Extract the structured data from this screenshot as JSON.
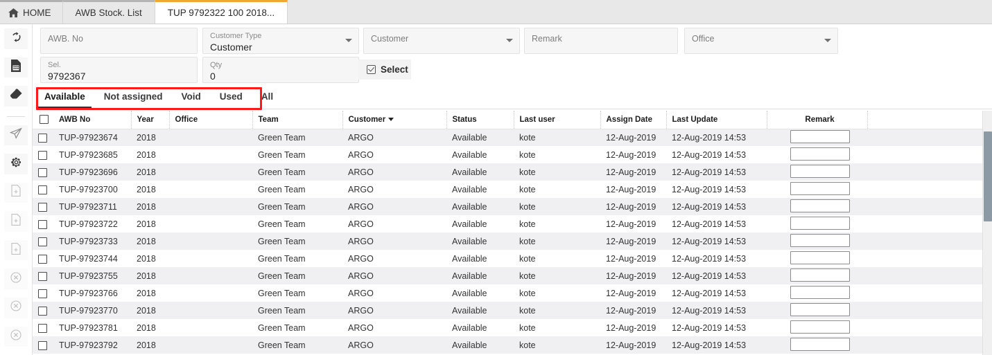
{
  "tabs": [
    {
      "label": "HOME",
      "icon": "home-icon",
      "active": false
    },
    {
      "label": "AWB Stock. List",
      "icon": "",
      "active": false
    },
    {
      "label": "TUP 9792322 100 2018...",
      "icon": "",
      "active": true
    }
  ],
  "rail": [
    {
      "name": "refresh-icon",
      "dim": false
    },
    {
      "name": "report-document-icon",
      "dim": false
    },
    {
      "name": "eraser-icon",
      "dim": false
    },
    {
      "name": "send-icon",
      "dim": false
    },
    {
      "name": "settings-gear-icon",
      "dim": false
    },
    {
      "name": "new-file-icon",
      "dim": true
    },
    {
      "name": "new-file-icon",
      "dim": true
    },
    {
      "name": "new-file-icon",
      "dim": true
    },
    {
      "name": "cancel-circle-icon",
      "dim": true
    },
    {
      "name": "cancel-circle-icon",
      "dim": true
    },
    {
      "name": "cancel-circle-icon",
      "dim": true
    }
  ],
  "form": {
    "awb_no": {
      "label": "AWB. No",
      "value": ""
    },
    "customer_type": {
      "label": "Customer Type",
      "value": "Customer"
    },
    "customer": {
      "label": "Customer",
      "value": ""
    },
    "remark": {
      "label": "Remark",
      "value": ""
    },
    "office": {
      "label": "Office",
      "value": ""
    },
    "sel": {
      "label": "Sel.",
      "value": "9792367"
    },
    "qty": {
      "label": "Qty",
      "value": "0"
    },
    "select_button": "Select"
  },
  "subtabs": [
    {
      "label": "Available",
      "active": true
    },
    {
      "label": "Not assigned",
      "active": false
    },
    {
      "label": "Void",
      "active": false
    },
    {
      "label": "Used",
      "active": false
    },
    {
      "label": "All",
      "active": false
    }
  ],
  "table": {
    "columns": [
      "AWB No",
      "Year",
      "Office",
      "Team",
      "Customer",
      "Status",
      "Last user",
      "Assign Date",
      "Last Update",
      "Remark"
    ],
    "sorted_column": "Customer",
    "rows": [
      {
        "awb": "TUP-97923674",
        "year": "2018",
        "office": "",
        "team": "Green Team",
        "customer": "ARGO",
        "status": "Available",
        "last_user": "kote",
        "assign_date": "12-Aug-2019",
        "last_update": "12-Aug-2019 14:53",
        "remark": ""
      },
      {
        "awb": "TUP-97923685",
        "year": "2018",
        "office": "",
        "team": "Green Team",
        "customer": "ARGO",
        "status": "Available",
        "last_user": "kote",
        "assign_date": "12-Aug-2019",
        "last_update": "12-Aug-2019 14:53",
        "remark": ""
      },
      {
        "awb": "TUP-97923696",
        "year": "2018",
        "office": "",
        "team": "Green Team",
        "customer": "ARGO",
        "status": "Available",
        "last_user": "kote",
        "assign_date": "12-Aug-2019",
        "last_update": "12-Aug-2019 14:53",
        "remark": ""
      },
      {
        "awb": "TUP-97923700",
        "year": "2018",
        "office": "",
        "team": "Green Team",
        "customer": "ARGO",
        "status": "Available",
        "last_user": "kote",
        "assign_date": "12-Aug-2019",
        "last_update": "12-Aug-2019 14:53",
        "remark": ""
      },
      {
        "awb": "TUP-97923711",
        "year": "2018",
        "office": "",
        "team": "Green Team",
        "customer": "ARGO",
        "status": "Available",
        "last_user": "kote",
        "assign_date": "12-Aug-2019",
        "last_update": "12-Aug-2019 14:53",
        "remark": ""
      },
      {
        "awb": "TUP-97923722",
        "year": "2018",
        "office": "",
        "team": "Green Team",
        "customer": "ARGO",
        "status": "Available",
        "last_user": "kote",
        "assign_date": "12-Aug-2019",
        "last_update": "12-Aug-2019 14:53",
        "remark": ""
      },
      {
        "awb": "TUP-97923733",
        "year": "2018",
        "office": "",
        "team": "Green Team",
        "customer": "ARGO",
        "status": "Available",
        "last_user": "kote",
        "assign_date": "12-Aug-2019",
        "last_update": "12-Aug-2019 14:53",
        "remark": ""
      },
      {
        "awb": "TUP-97923744",
        "year": "2018",
        "office": "",
        "team": "Green Team",
        "customer": "ARGO",
        "status": "Available",
        "last_user": "kote",
        "assign_date": "12-Aug-2019",
        "last_update": "12-Aug-2019 14:53",
        "remark": ""
      },
      {
        "awb": "TUP-97923755",
        "year": "2018",
        "office": "",
        "team": "Green Team",
        "customer": "ARGO",
        "status": "Available",
        "last_user": "kote",
        "assign_date": "12-Aug-2019",
        "last_update": "12-Aug-2019 14:53",
        "remark": ""
      },
      {
        "awb": "TUP-97923766",
        "year": "2018",
        "office": "",
        "team": "Green Team",
        "customer": "ARGO",
        "status": "Available",
        "last_user": "kote",
        "assign_date": "12-Aug-2019",
        "last_update": "12-Aug-2019 14:53",
        "remark": ""
      },
      {
        "awb": "TUP-97923770",
        "year": "2018",
        "office": "",
        "team": "Green Team",
        "customer": "ARGO",
        "status": "Available",
        "last_user": "kote",
        "assign_date": "12-Aug-2019",
        "last_update": "12-Aug-2019 14:53",
        "remark": ""
      },
      {
        "awb": "TUP-97923781",
        "year": "2018",
        "office": "",
        "team": "Green Team",
        "customer": "ARGO",
        "status": "Available",
        "last_user": "kote",
        "assign_date": "12-Aug-2019",
        "last_update": "12-Aug-2019 14:53",
        "remark": ""
      },
      {
        "awb": "TUP-97923792",
        "year": "2018",
        "office": "",
        "team": "Green Team",
        "customer": "ARGO",
        "status": "Available",
        "last_user": "kote",
        "assign_date": "12-Aug-2019",
        "last_update": "12-Aug-2019 14:53",
        "remark": ""
      }
    ]
  },
  "colors": {
    "active_tab_accent": "#f0a832",
    "annotation": "#ff1a1a",
    "row_alt": "#f0f0f2",
    "scroll_thumb": "#8b9aa5"
  }
}
